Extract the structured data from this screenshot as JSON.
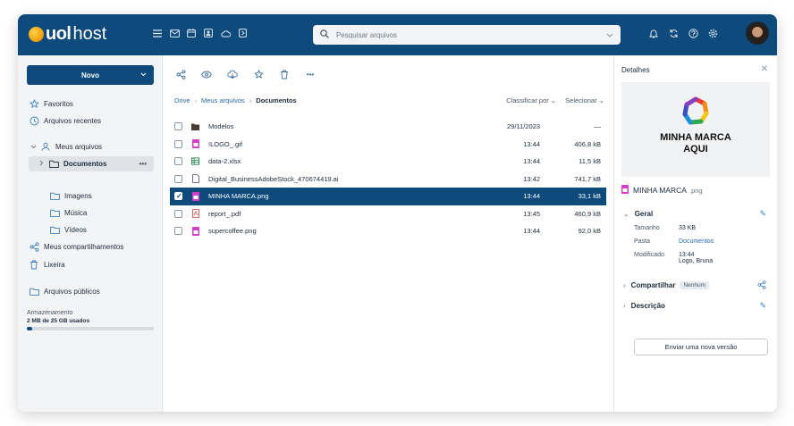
{
  "brand": {
    "uol": "uol",
    "host": "host"
  },
  "search": {
    "placeholder": "Pesquisar arquivos"
  },
  "topbar_icons": [
    "menu-icon",
    "mail-icon",
    "calendar-icon",
    "contacts-icon",
    "cloud-icon",
    "docs-icon"
  ],
  "topbar_right_icons": [
    "bell-icon",
    "sync-icon",
    "help-icon",
    "settings-icon"
  ],
  "sidebar": {
    "new_button": "Novo",
    "favorites": "Favoritos",
    "recent": "Arquivos recentes",
    "my_files": "Meus arquivos",
    "documents": "Documentos",
    "images": "Imagens",
    "music": "Música",
    "videos": "Vídeos",
    "shares": "Meus compartilhamentos",
    "trash": "Lixeira",
    "public": "Arquivos públicos",
    "storage_label": "Armazenamento",
    "storage_value": "2 MB de 25 GB usados",
    "storage_fraction": 0.0001
  },
  "breadcrumb": {
    "drive": "Drive",
    "my_files": "Meus arquivos",
    "current": "Documentos"
  },
  "sort": {
    "sort_by": "Classificar por",
    "select": "Selecionar"
  },
  "files": [
    {
      "name": "Modelos",
      "date": "29/11/2023",
      "size": "—",
      "type": "folder",
      "selected": false
    },
    {
      "name": "!LOGO_.gif",
      "date": "13:44",
      "size": "406,8 kB",
      "type": "image",
      "selected": false
    },
    {
      "name": "data-2.xlsx",
      "date": "13:44",
      "size": "11,5 kB",
      "type": "sheet",
      "selected": false
    },
    {
      "name": "Digital_BusinessAdobeStock_470674419.ai",
      "date": "13:42",
      "size": "741,7 kB",
      "type": "file",
      "selected": false
    },
    {
      "name": "MINHA MARCA.png",
      "date": "13:44",
      "size": "33,1 kB",
      "type": "image",
      "selected": true
    },
    {
      "name": "report_.pdf",
      "date": "13:45",
      "size": "460,9 kB",
      "type": "pdf",
      "selected": false
    },
    {
      "name": "supercoffee.png",
      "date": "13:44",
      "size": "92,0 kB",
      "type": "image",
      "selected": false
    }
  ],
  "details": {
    "title": "Detalhes",
    "preview_line1": "MINHA MARCA",
    "preview_line2": "AQUI",
    "file_name": "MINHA MARCA",
    "file_ext": ".png",
    "general": "Geral",
    "size_label": "Tamanho",
    "size_value": "33 KB",
    "folder_label": "Pasta",
    "folder_value": "Documentos",
    "modified_label": "Modificado",
    "modified_time": "13:44",
    "modified_by": "Logo, Bruna",
    "share": "Compartilhar",
    "share_badge": "Nenhum",
    "description": "Descrição",
    "new_version": "Enviar uma nova versão"
  },
  "colors": {
    "primary": "#0e4b7c",
    "accent": "#3a7fbf",
    "sidebar_bg": "#f3f4f6"
  }
}
